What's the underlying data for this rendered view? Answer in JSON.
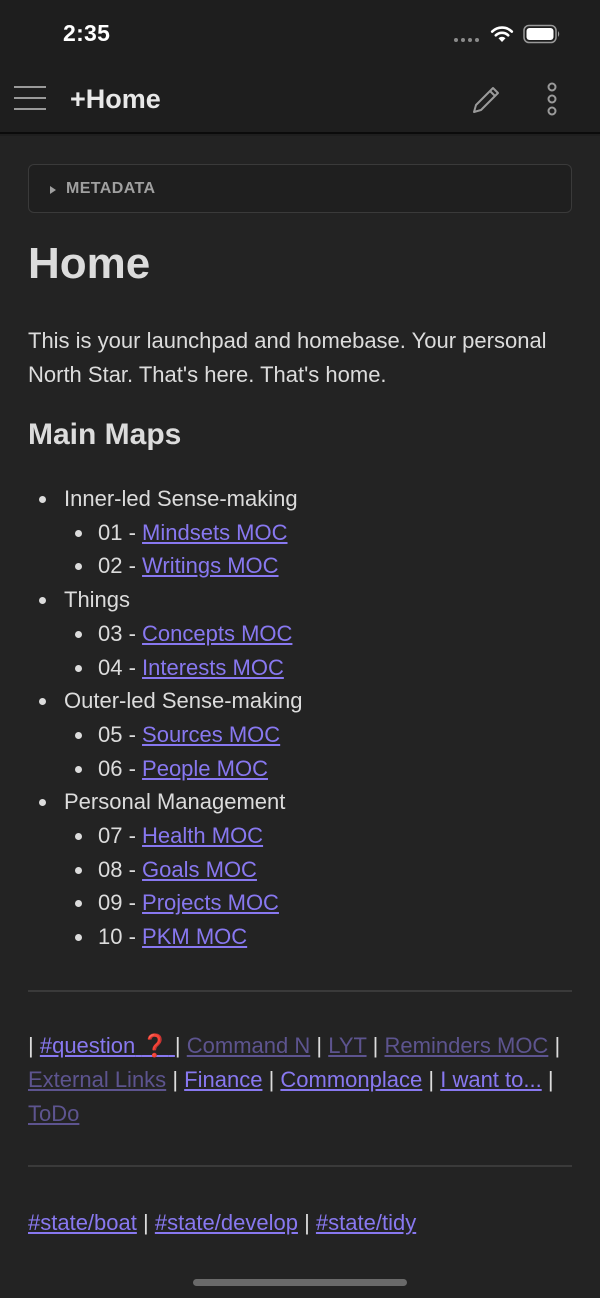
{
  "status_bar": {
    "time": "2:35"
  },
  "header": {
    "title": "+Home"
  },
  "metadata": {
    "label": "METADATA"
  },
  "page": {
    "heading": "Home",
    "intro": "This is your launchpad and homebase. Your personal North Star. That's here. That's home.",
    "section_heading": "Main Maps"
  },
  "maps": [
    {
      "label": "Inner-led Sense-making",
      "items": [
        {
          "num": "01 - ",
          "link": "Mindsets MOC"
        },
        {
          "num": "02 - ",
          "link": "Writings MOC"
        }
      ]
    },
    {
      "label": "Things",
      "items": [
        {
          "num": "03 - ",
          "link": "Concepts MOC"
        },
        {
          "num": "04 - ",
          "link": "Interests MOC"
        }
      ]
    },
    {
      "label": "Outer-led Sense-making",
      "items": [
        {
          "num": "05 - ",
          "link": "Sources MOC"
        },
        {
          "num": "06 - ",
          "link": "People MOC"
        }
      ]
    },
    {
      "label": "Personal Management",
      "items": [
        {
          "num": "07 - ",
          "link": "Health MOC"
        },
        {
          "num": "08 - ",
          "link": "Goals MOC"
        },
        {
          "num": "09 - ",
          "link": "Projects MOC"
        },
        {
          "num": "10 - ",
          "link": "PKM MOC"
        }
      ]
    }
  ],
  "tag_links": [
    {
      "text": "#question",
      "emoji": "❓",
      "dim": false
    },
    {
      "text": "Command N",
      "dim": true
    },
    {
      "text": "LYT",
      "dim": true
    },
    {
      "text": "Reminders MOC",
      "dim": true
    },
    {
      "text": "External Links",
      "dim": true
    },
    {
      "text": "Finance",
      "dim": false
    },
    {
      "text": "Commonplace",
      "dim": false
    },
    {
      "text": "I want to...",
      "dim": false
    },
    {
      "text": "ToDo",
      "dim": true
    }
  ],
  "state_tags": [
    "#state/boat",
    "#state/develop",
    "#state/tidy"
  ],
  "colors": {
    "link": "#8878f0",
    "link_unresolved": "#5d548f",
    "background": "#232323",
    "header": "#1e1e1e"
  },
  "icons": [
    "menu-icon",
    "pencil-icon",
    "more-vertical-icon",
    "wifi-icon",
    "battery-icon",
    "caret-right-icon"
  ]
}
